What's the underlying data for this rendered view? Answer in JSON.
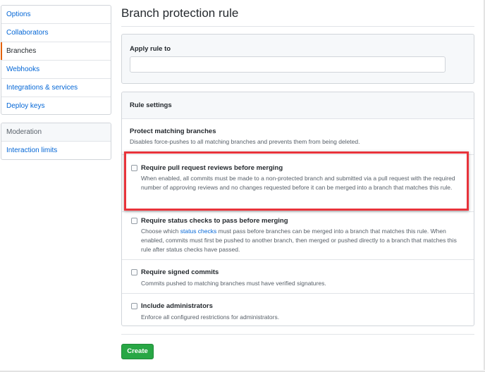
{
  "sidebar": {
    "items": [
      {
        "label": "Options"
      },
      {
        "label": "Collaborators"
      },
      {
        "label": "Branches"
      },
      {
        "label": "Webhooks"
      },
      {
        "label": "Integrations & services"
      },
      {
        "label": "Deploy keys"
      }
    ],
    "moderation": {
      "heading": "Moderation",
      "items": [
        {
          "label": "Interaction limits"
        }
      ]
    }
  },
  "main": {
    "title": "Branch protection rule",
    "apply": {
      "label": "Apply rule to",
      "value": "",
      "placeholder": ""
    },
    "rules": {
      "header": "Rule settings",
      "protect_title": "Protect matching branches",
      "protect_desc": "Disables force-pushes to all matching branches and prevents them from being deleted.",
      "options": [
        {
          "title": "Require pull request reviews before merging",
          "desc": "When enabled, all commits must be made to a non-protected branch and submitted via a pull request with the required number of approving reviews and no changes requested before it can be merged into a branch that matches this rule."
        },
        {
          "title": "Require status checks to pass before merging",
          "desc_before": "Choose which ",
          "desc_link": "status checks",
          "desc_after": " must pass before branches can be merged into a branch that matches this rule. When enabled, commits must first be pushed to another branch, then merged or pushed directly to a branch that matches this rule after status checks have passed."
        },
        {
          "title": "Require signed commits",
          "desc": "Commits pushed to matching branches must have verified signatures."
        },
        {
          "title": "Include administrators",
          "desc": "Enforce all configured restrictions for administrators."
        }
      ]
    },
    "create_label": "Create"
  },
  "colors": {
    "link": "#0366d6",
    "selected_accent": "#e36209",
    "create_button": "#28a745",
    "highlight_box": "#e8333b"
  }
}
